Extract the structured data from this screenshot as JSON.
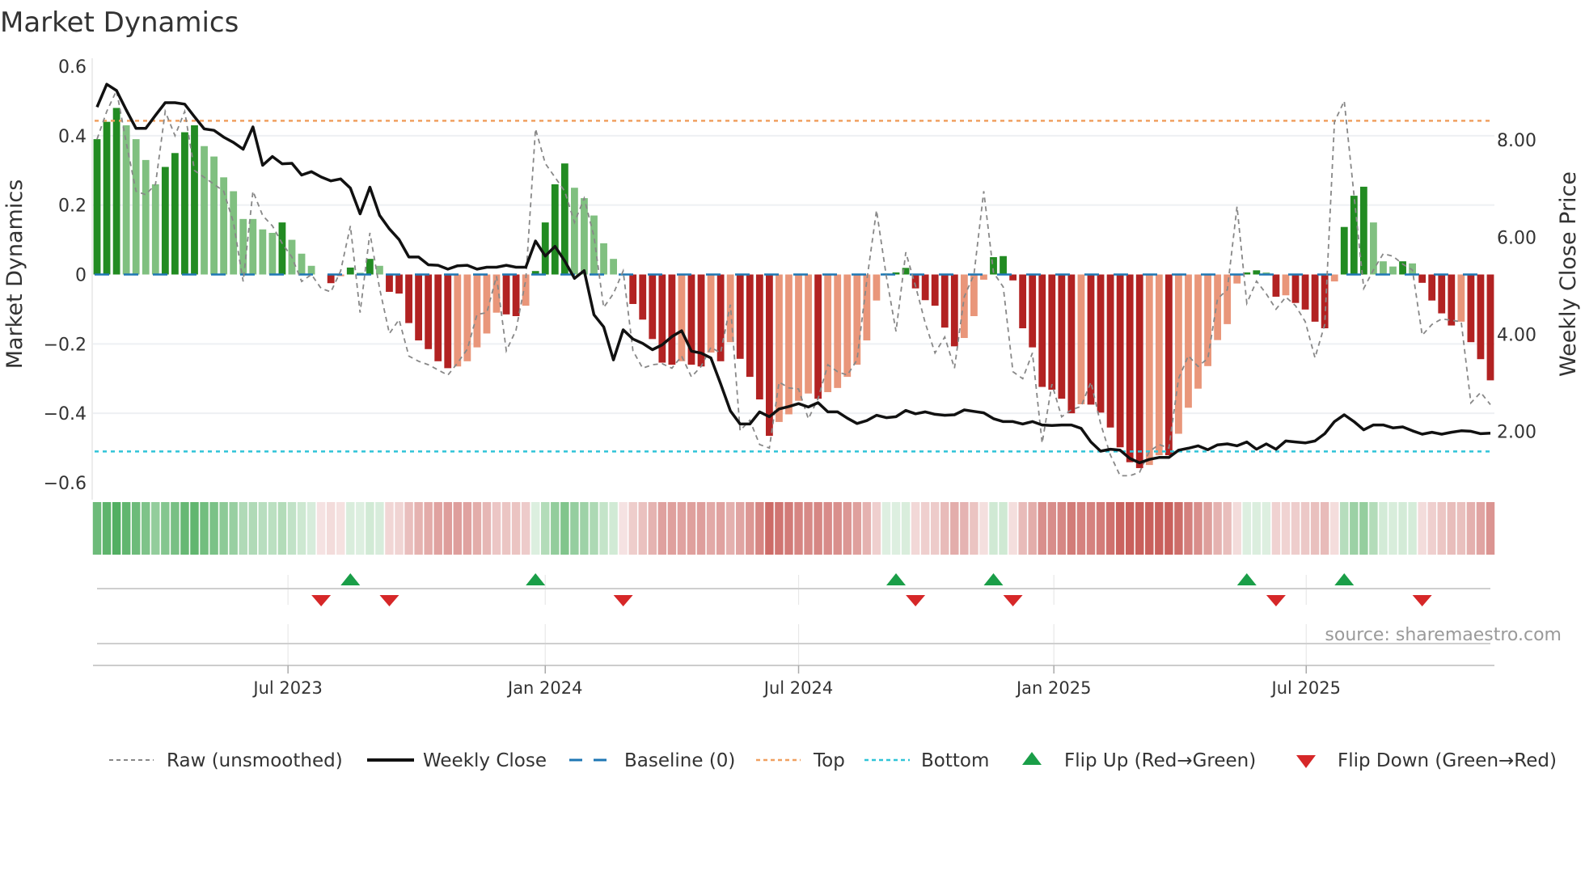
{
  "title": "Market Dynamics",
  "source": "source: sharemaestro.com",
  "legend": {
    "raw": "Raw (unsmoothed)",
    "close": "Weekly Close",
    "baseline": "Baseline (0)",
    "top": "Top",
    "bottom": "Bottom",
    "flip_up": "Flip Up (Red→Green)",
    "flip_down": "Flip Down (Green→Red)"
  },
  "colors": {
    "pos_strong": "#228b22",
    "pos_weak": "#80c080",
    "neg_strong": "#b22222",
    "neg_weak": "#e9967a",
    "baseline": "#1f77b4",
    "top": "#f0a060",
    "bottom": "#30c4d8",
    "close": "#111111",
    "raw": "#888888",
    "flip_up": "#1a9e48",
    "flip_down": "#d62728",
    "strip_pos": "#4aab5a",
    "strip_neg": "#c9605c"
  },
  "chart_data": {
    "type": "bar",
    "title": "Market Dynamics",
    "ylabel": "Market Dynamics",
    "y2label": "Weekly Close Price",
    "ylim": [
      -0.6,
      0.6
    ],
    "y2lim": [
      0.94,
      9.52
    ],
    "yticks": [
      "0.6",
      "0.4",
      "0.2",
      "0",
      "−0.2",
      "−0.4",
      "−0.6"
    ],
    "ytick_values": [
      0.6,
      0.4,
      0.2,
      0,
      -0.2,
      -0.4,
      -0.6
    ],
    "y2ticks": [
      "8.00",
      "6.00",
      "4.00",
      "2.00"
    ],
    "y2tick_values": [
      8,
      6,
      4,
      2
    ],
    "xticks": [
      {
        "label": "Jul 2023",
        "week_index": 19.6
      },
      {
        "label": "Jan 2024",
        "week_index": 46.0
      },
      {
        "label": "Jul 2024",
        "week_index": 72.0
      },
      {
        "label": "Jan 2025",
        "week_index": 98.2
      },
      {
        "label": "Jul 2025",
        "week_index": 124.1
      }
    ],
    "top": 0.443,
    "bottom": -0.51,
    "baseline": 0,
    "values": [
      0.39,
      0.44,
      0.48,
      0.43,
      0.39,
      0.33,
      0.26,
      0.31,
      0.35,
      0.41,
      0.43,
      0.37,
      0.34,
      0.28,
      0.24,
      0.16,
      0.16,
      0.13,
      0.12,
      0.15,
      0.1,
      0.06,
      0.025,
      0,
      -0.025,
      -0.005,
      0.02,
      0.005,
      0.045,
      0.025,
      -0.05,
      -0.055,
      -0.14,
      -0.19,
      -0.215,
      -0.25,
      -0.27,
      -0.265,
      -0.25,
      -0.21,
      -0.17,
      -0.11,
      -0.115,
      -0.12,
      -0.09,
      0.01,
      0.15,
      0.26,
      0.32,
      0.25,
      0.22,
      0.17,
      0.09,
      0.045,
      0,
      -0.085,
      -0.13,
      -0.186,
      -0.254,
      -0.26,
      -0.25,
      -0.26,
      -0.265,
      -0.225,
      -0.25,
      -0.195,
      -0.243,
      -0.295,
      -0.36,
      -0.465,
      -0.425,
      -0.403,
      -0.364,
      -0.343,
      -0.358,
      -0.339,
      -0.327,
      -0.295,
      -0.26,
      -0.19,
      -0.075,
      0.003,
      0.006,
      0.019,
      -0.04,
      -0.074,
      -0.09,
      -0.153,
      -0.207,
      -0.183,
      -0.12,
      -0.015,
      0.05,
      0.053,
      -0.017,
      -0.155,
      -0.21,
      -0.324,
      -0.332,
      -0.358,
      -0.4,
      -0.374,
      -0.375,
      -0.398,
      -0.441,
      -0.498,
      -0.541,
      -0.558,
      -0.549,
      -0.521,
      -0.521,
      -0.459,
      -0.384,
      -0.329,
      -0.264,
      -0.189,
      -0.143,
      -0.026,
      0.006,
      0.012,
      0.006,
      -0.064,
      -0.06,
      -0.082,
      -0.101,
      -0.136,
      -0.155,
      -0.02,
      0.137,
      0.227,
      0.253,
      0.15,
      0.038,
      0.023,
      0.038,
      0.032,
      -0.024,
      -0.075,
      -0.112,
      -0.147,
      -0.136,
      -0.195,
      -0.244,
      -0.305
    ],
    "strength": "DDDLLLLDDDDLLLLLLLLDLLLLDLDLDLDDDDDDDLLLLLDDLDDDDLLLLLLDDDDDLDDLDLDDDDLLLLDLLLLLLLDDDDDDDLLLDDDDDDDDDLDDDDDDLLDLLLLLLLDDLDLDDDDLDDDLLLDLDDDDLDDD",
    "close": [
      8.68,
      9.15,
      9.02,
      8.62,
      8.24,
      8.24,
      8.51,
      8.77,
      8.77,
      8.74,
      8.48,
      8.23,
      8.2,
      8.06,
      7.95,
      7.81,
      8.27,
      7.48,
      7.66,
      7.51,
      7.52,
      7.28,
      7.35,
      7.24,
      7.16,
      7.2,
      7.01,
      6.48,
      7.03,
      6.45,
      6.17,
      5.95,
      5.59,
      5.59,
      5.43,
      5.42,
      5.34,
      5.41,
      5.42,
      5.34,
      5.38,
      5.38,
      5.42,
      5.38,
      5.38,
      5.92,
      5.61,
      5.81,
      5.51,
      5.15,
      5.31,
      4.4,
      4.15,
      3.47,
      4.09,
      3.9,
      3.81,
      3.68,
      3.78,
      3.95,
      4.07,
      3.65,
      3.61,
      3.51,
      2.98,
      2.42,
      2.15,
      2.15,
      2.4,
      2.3,
      2.46,
      2.51,
      2.57,
      2.5,
      2.59,
      2.4,
      2.4,
      2.27,
      2.16,
      2.22,
      2.33,
      2.28,
      2.3,
      2.43,
      2.36,
      2.4,
      2.35,
      2.33,
      2.34,
      2.44,
      2.41,
      2.38,
      2.26,
      2.2,
      2.2,
      2.15,
      2.2,
      2.13,
      2.12,
      2.13,
      2.13,
      2.06,
      1.78,
      1.59,
      1.63,
      1.61,
      1.44,
      1.35,
      1.42,
      1.46,
      1.46,
      1.61,
      1.65,
      1.7,
      1.62,
      1.72,
      1.74,
      1.7,
      1.78,
      1.63,
      1.74,
      1.63,
      1.8,
      1.78,
      1.76,
      1.8,
      1.95,
      2.2,
      2.34,
      2.2,
      2.03,
      2.13,
      2.13,
      2.07,
      2.09,
      2.01,
      1.94,
      1.98,
      1.94,
      1.98,
      2.01,
      2.0,
      1.95,
      1.96
    ],
    "raw": [
      0.39,
      0.47,
      0.53,
      0.38,
      0.24,
      0.23,
      0.26,
      0.47,
      0.4,
      0.47,
      0.3,
      0.28,
      0.26,
      0.24,
      0.15,
      -0.02,
      0.24,
      0.17,
      0.14,
      0.09,
      0.05,
      -0.02,
      0.0,
      -0.04,
      -0.05,
      0.01,
      0.14,
      -0.11,
      0.12,
      -0.04,
      -0.17,
      -0.13,
      -0.235,
      -0.25,
      -0.26,
      -0.275,
      -0.29,
      -0.255,
      -0.215,
      -0.115,
      -0.11,
      -0.005,
      -0.22,
      -0.16,
      -0.015,
      0.42,
      0.32,
      0.28,
      0.24,
      0.15,
      0.22,
      0.11,
      -0.095,
      -0.055,
      0.01,
      -0.22,
      -0.27,
      -0.26,
      -0.257,
      -0.27,
      -0.235,
      -0.295,
      -0.265,
      -0.21,
      -0.226,
      -0.087,
      -0.45,
      -0.42,
      -0.49,
      -0.5,
      -0.31,
      -0.327,
      -0.33,
      -0.416,
      -0.358,
      -0.26,
      -0.28,
      -0.29,
      -0.246,
      -0.017,
      0.185,
      -0.005,
      -0.164,
      0.064,
      -0.033,
      -0.14,
      -0.226,
      -0.18,
      -0.27,
      -0.064,
      0.0,
      0.24,
      0.006,
      -0.036,
      -0.28,
      -0.3,
      -0.226,
      -0.486,
      -0.316,
      -0.41,
      -0.39,
      -0.38,
      -0.31,
      -0.43,
      -0.52,
      -0.58,
      -0.58,
      -0.57,
      -0.51,
      -0.49,
      -0.5,
      -0.3,
      -0.234,
      -0.265,
      -0.242,
      -0.07,
      -0.044,
      0.196,
      -0.083,
      -0.019,
      -0.056,
      -0.1,
      -0.065,
      -0.09,
      -0.136,
      -0.24,
      -0.144,
      0.44,
      0.5,
      0.23,
      -0.04,
      0.013,
      0.06,
      0.053,
      0.03,
      0.013,
      -0.175,
      -0.144,
      -0.128,
      -0.132,
      -0.136,
      -0.37,
      -0.34,
      -0.375
    ],
    "flip_up_weeks": [
      26,
      45,
      82,
      92,
      118,
      128
    ],
    "flip_down_weeks": [
      23,
      30,
      54,
      84,
      94,
      121,
      136
    ],
    "legend_position": "bottom",
    "grid": true
  }
}
